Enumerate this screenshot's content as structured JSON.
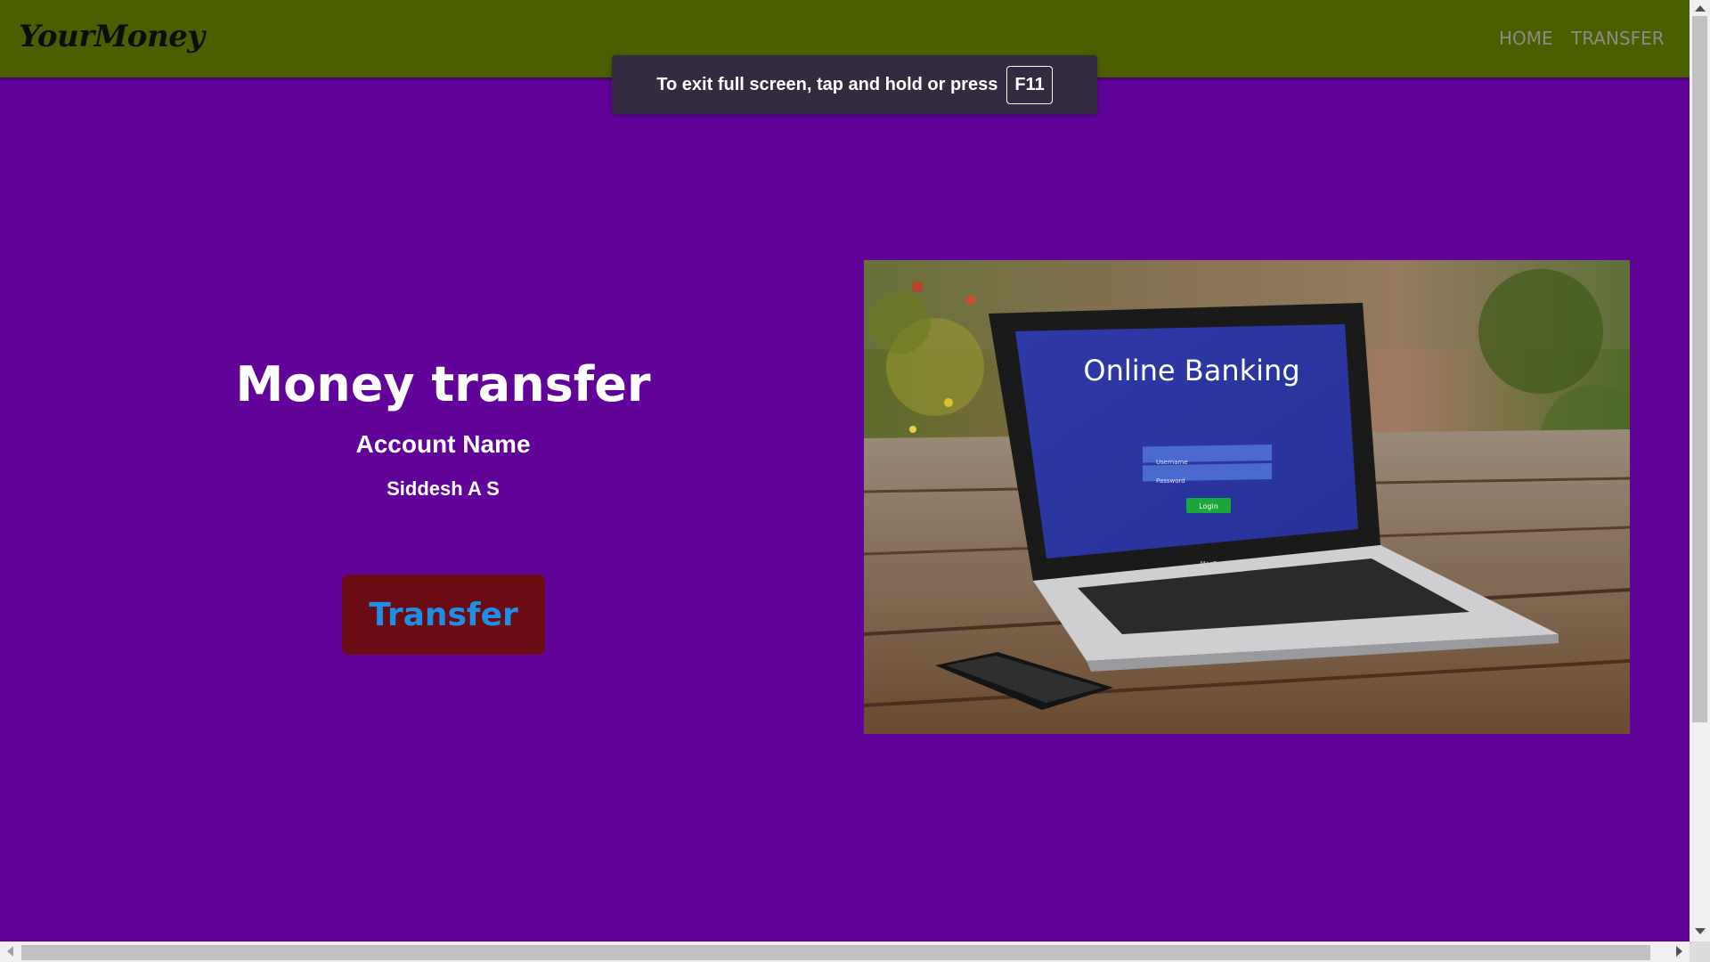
{
  "navbar": {
    "brand": "YourMoney",
    "links": [
      {
        "label": "HOME"
      },
      {
        "label": "TRANSFER"
      }
    ]
  },
  "fullscreen_notice": {
    "message": "To exit full screen, tap and hold or press",
    "key": "F11"
  },
  "hero": {
    "title": "Money transfer",
    "account_label": "Account Name",
    "account_name": "Siddesh A S",
    "button_label": "Transfer"
  },
  "image": {
    "screen_title": "Online Banking",
    "username_placeholder": "Username",
    "password_placeholder": "Password",
    "login_label": "Login",
    "laptop_model": "MacBook Pro"
  },
  "colors": {
    "navbar_bg": "#4a5f00",
    "page_bg": "#610399",
    "button_bg": "#6b0b14",
    "button_text": "#1f8fe6"
  }
}
